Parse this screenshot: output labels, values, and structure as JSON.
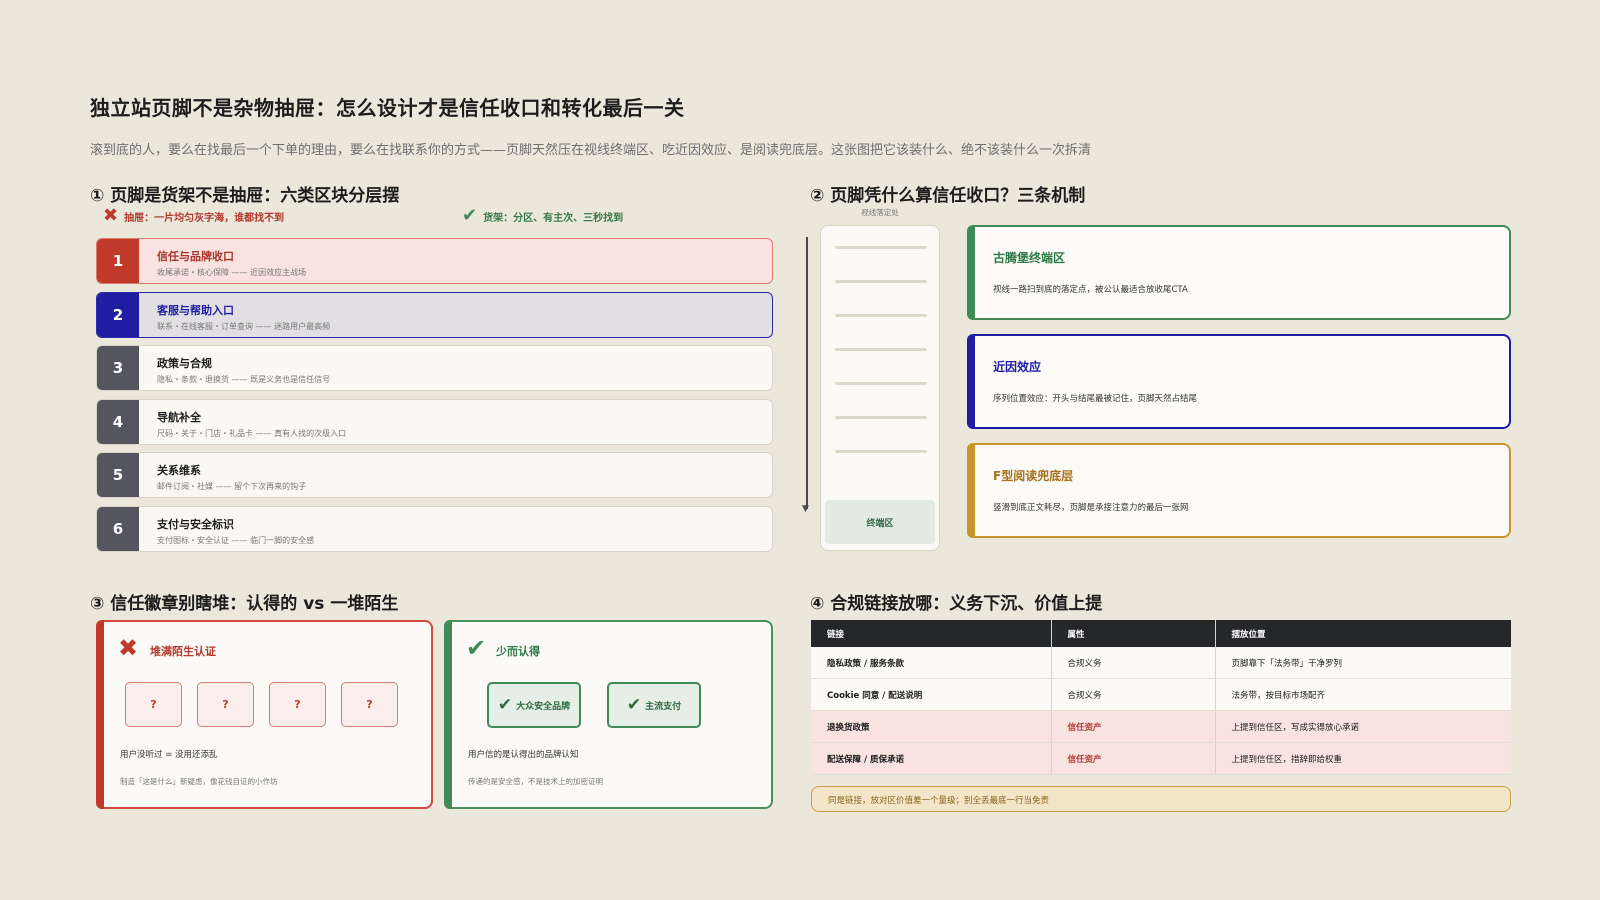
{
  "page": {
    "title": "独立站页脚不是杂物抽屉：怎么设计才是信任收口和转化最后一关",
    "subtitle": "滚到底的人，要么在找最后一个下单的理由，要么在找联系你的方式——页脚天然压在视线终端区、吃近因效应、是阅读兜底层。这张图把它该装什么、绝不该装什么一次拆清"
  },
  "colors": {
    "background": "#ebe7da",
    "red": "#c0392b",
    "navy": "#1f1ea3",
    "slate": "#55555f",
    "green": "#3f8a56",
    "gold": "#c8952c",
    "dark": "#26272b"
  },
  "section1": {
    "title": "① 页脚是货架不是抽屉：六类区块分层摆",
    "bad_label": "抽屉：一片均匀灰字海，谁都找不到",
    "good_label": "货架：分区、有主次、三秒找到",
    "bad_icon": "cross-icon",
    "good_icon": "check-icon",
    "rows": [
      {
        "num": "1",
        "title": "信任与品牌收口",
        "desc": "收尾承诺・核心保障 —— 近因效应主战场",
        "accent": "#c0392b",
        "bg": "#f9e2df",
        "border": "#d77a70"
      },
      {
        "num": "2",
        "title": "客服与帮助入口",
        "desc": "联系・在线客服・订单查询 —— 迷路用户最高频",
        "accent": "#1f1ea3",
        "bg": "#e1dfe2",
        "border": "#2c2ba8"
      },
      {
        "num": "3",
        "title": "政策与合规",
        "desc": "隐私・条款・退换货 —— 既是义务也是信任信号",
        "accent": "#55555f",
        "bg": "#faf8f3",
        "border": "#d8d3c7"
      },
      {
        "num": "4",
        "title": "导航补全",
        "desc": "尺码・关于・门店・礼品卡 —— 真有人找的次级入口",
        "accent": "#55555f",
        "bg": "#faf8f3",
        "border": "#d8d3c7"
      },
      {
        "num": "5",
        "title": "关系维系",
        "desc": "邮件订阅・社媒 —— 留个下次再来的钩子",
        "accent": "#55555f",
        "bg": "#faf8f3",
        "border": "#d8d3c7"
      },
      {
        "num": "6",
        "title": "支付与安全标识",
        "desc": "支付图标・安全认证 —— 临门一脚的安全感",
        "accent": "#55555f",
        "bg": "#faf8f3",
        "border": "#d8d3c7"
      }
    ]
  },
  "section2": {
    "title": "② 页脚凭什么算信任收口？三条机制",
    "phone_caption": "视线落定处",
    "terminal_label": "终端区",
    "cards": [
      {
        "title": "古腾堡终端区",
        "desc": "视线一路扫到底的落定点，被公认最适合放收尾CTA",
        "color": "#3f8a56",
        "title_color": "#2e7a46"
      },
      {
        "title": "近因效应",
        "desc": "序列位置效应：开头与结尾最被记住，页脚天然占结尾",
        "color": "#1f1ea3",
        "title_color": "#1f1ea3"
      },
      {
        "title": "F型阅读兜底层",
        "desc": "竖滑到底正文耗尽，页脚是承接注意力的最后一张网",
        "color": "#c8952c",
        "title_color": "#a8711c"
      }
    ]
  },
  "section3": {
    "title": "③ 信任徽章别瞎堆：认得的 vs 一堆陌生",
    "bad": {
      "title": "堆满陌生认证",
      "badges": [
        "?",
        "?",
        "?",
        "?"
      ],
      "line1": "用户没听过 = 没用还添乱",
      "line2": "制造「这是什么」新疑虑，像花钱自证的小作坊"
    },
    "good": {
      "title": "少而认得",
      "badges": [
        "大众安全品牌",
        "主流支付"
      ],
      "line1": "用户信的是认得出的品牌认知",
      "line2": "传递的是安全感，不是技术上的加密证明"
    }
  },
  "section4": {
    "title": "④ 合规链接放哪：义务下沉、价值上提",
    "headers": [
      "链接",
      "属性",
      "摆放位置"
    ],
    "rows": [
      {
        "link": "隐私政策 / 服务条款",
        "prop": "合规义务",
        "place": "页脚靠下「法务带」干净罗列",
        "type": "obligation"
      },
      {
        "link": "Cookie 同意 / 配送说明",
        "prop": "合规义务",
        "place": "法务带，按目标市场配齐",
        "type": "obligation"
      },
      {
        "link": "退换货政策",
        "prop": "信任资产",
        "place": "上提到信任区，写成实得放心承诺",
        "type": "value"
      },
      {
        "link": "配送保障 / 质保承诺",
        "prop": "信任资产",
        "place": "上提到信任区，措辞即给权重",
        "type": "value"
      }
    ],
    "note": "同是链接，放对区价值差一个量级；别全丢最底一行当免责"
  }
}
